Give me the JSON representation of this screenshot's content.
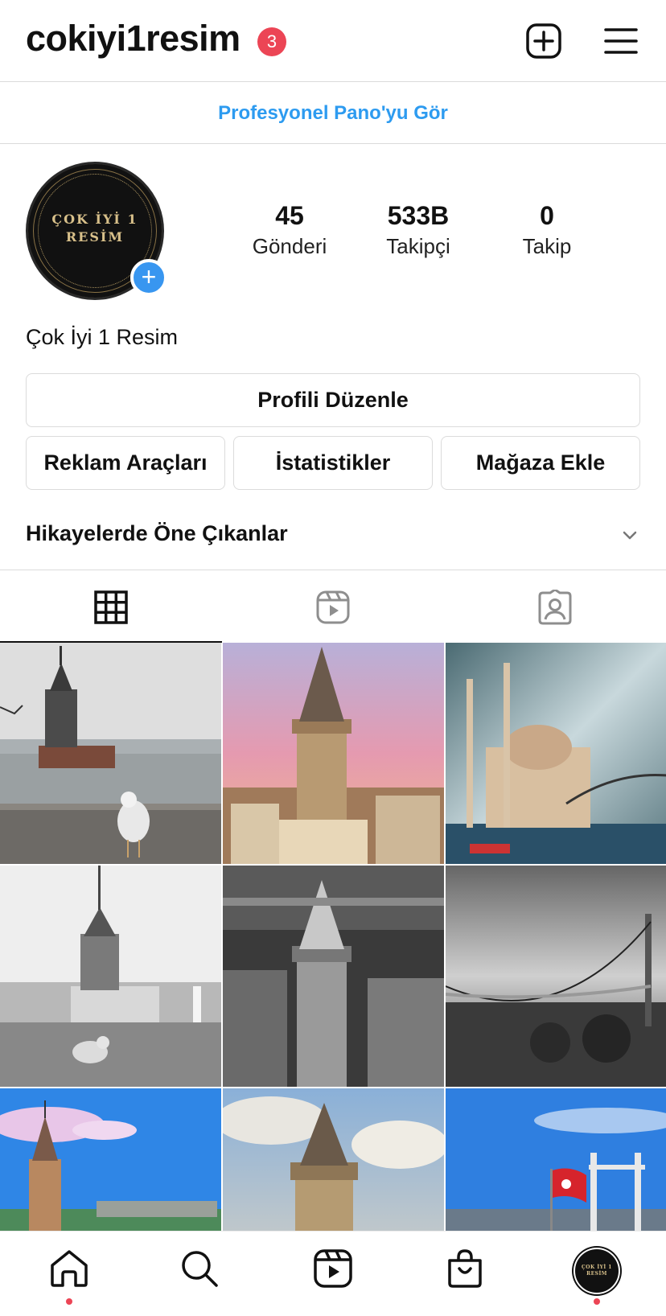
{
  "header": {
    "username": "cokiyi1resim",
    "notification_count": "3",
    "add_icon": "plus-square-icon",
    "menu_icon": "hamburger-menu-icon"
  },
  "pro_dashboard": {
    "label": "Profesyonel Pano'yu Gör"
  },
  "profile": {
    "avatar_line1": "ÇOK İYİ 1",
    "avatar_line2": "RESİM",
    "display_name": "Çok İyi 1 Resim",
    "stats": [
      {
        "value": "45",
        "label": "Gönderi"
      },
      {
        "value": "533B",
        "label": "Takipçi"
      },
      {
        "value": "0",
        "label": "Takip"
      }
    ]
  },
  "buttons": {
    "edit_profile": "Profili Düzenle",
    "ad_tools": "Reklam Araçları",
    "insights": "İstatistikler",
    "add_shop": "Mağaza Ekle"
  },
  "highlights": {
    "label": "Hikayelerde Öne Çıkanlar"
  },
  "tabs": [
    {
      "icon": "grid-icon",
      "active": true
    },
    {
      "icon": "reels-icon",
      "active": false
    },
    {
      "icon": "tagged-icon",
      "active": false
    }
  ],
  "posts": [
    {
      "subject": "Maiden's Tower with seagull"
    },
    {
      "subject": "Galata Tower at sunset"
    },
    {
      "subject": "Ortakoy Mosque and bridge"
    },
    {
      "subject": "Maiden's Tower black and white"
    },
    {
      "subject": "Galata Tower black and white"
    },
    {
      "subject": "Bosphorus Bridge black and white"
    },
    {
      "subject": "Maiden's Tower blue sky"
    },
    {
      "subject": "Galata Tower clouds"
    },
    {
      "subject": "Turkish flag and bridge"
    }
  ],
  "bottom_nav": [
    {
      "icon": "home-icon",
      "notification": true
    },
    {
      "icon": "search-icon",
      "notification": false
    },
    {
      "icon": "reels-icon",
      "notification": false
    },
    {
      "icon": "shop-icon",
      "notification": false
    },
    {
      "icon": "profile-avatar",
      "notification": true
    }
  ]
}
